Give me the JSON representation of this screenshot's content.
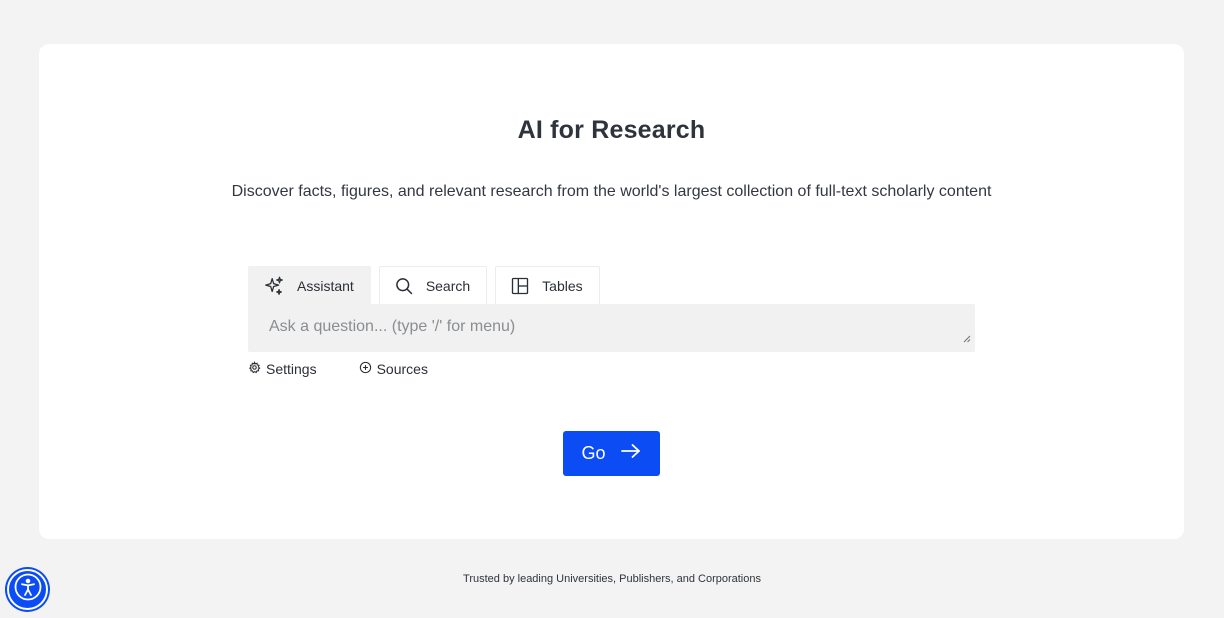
{
  "hero": {
    "title": "AI for Research",
    "subtitle": "Discover facts, figures, and relevant research from the world's largest collection of full-text scholarly content"
  },
  "tabs": [
    {
      "label": "Assistant",
      "icon": "sparkles-icon",
      "active": true
    },
    {
      "label": "Search",
      "icon": "search-icon",
      "active": false
    },
    {
      "label": "Tables",
      "icon": "table-layout-icon",
      "active": false
    }
  ],
  "query": {
    "placeholder": "Ask a question... (type '/' for menu)",
    "value": ""
  },
  "options": {
    "settings_label": "Settings",
    "sources_label": "Sources"
  },
  "go_button": {
    "label": "Go"
  },
  "footer": {
    "text": "Trusted by leading Universities, Publishers, and Corporations"
  },
  "colors": {
    "accent": "#0b4cf5",
    "background": "#f3f3f3",
    "card": "#ffffff",
    "input_bg": "#f1f1f1"
  }
}
